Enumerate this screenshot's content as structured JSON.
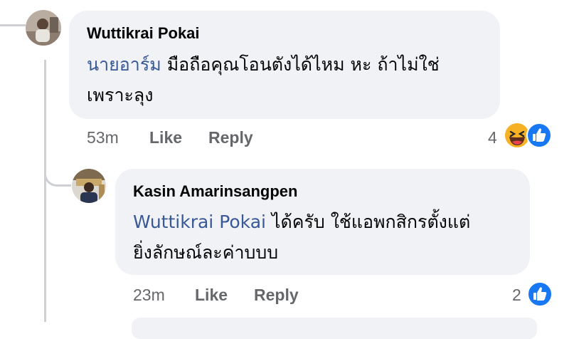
{
  "comments": [
    {
      "author": "Wuttikrai Pokai",
      "mention": "นายอาร์ม",
      "line1": " มือถือคุณโอนตังได้ไหม หะ ถ้าไม่ใช่",
      "line2": "เพราะลุง",
      "time": "53m",
      "like_label": "Like",
      "reply_label": "Reply",
      "reaction_count": "4",
      "reactions": [
        "haha-icon",
        "like-icon"
      ]
    },
    {
      "author": "Kasin Amarinsangpen",
      "mention": "Wuttikrai Pokai",
      "line1": " ได้ครับ ใช้แอพกสิกรตั้งแต่",
      "line2": "ยิ่งลักษณ์ละค่าบบบ",
      "time": "23m",
      "like_label": "Like",
      "reply_label": "Reply",
      "reaction_count": "2",
      "reactions": [
        "like-icon"
      ]
    }
  ],
  "colors": {
    "bubble": "#f0f2f5",
    "mention": "#385898",
    "meta": "#65676b",
    "like_blue": "#1877f2",
    "thread_line": "#ced0d4"
  }
}
